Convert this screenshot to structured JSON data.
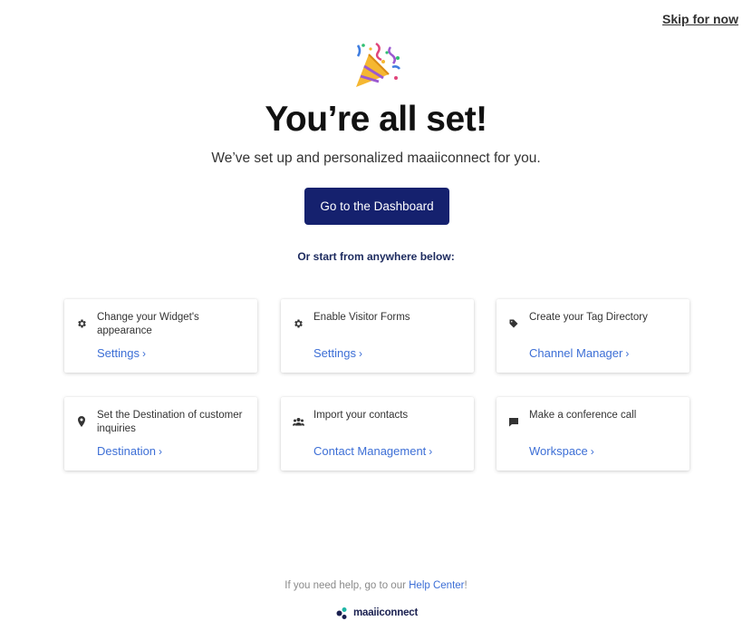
{
  "header": {
    "skip_label": "Skip for now"
  },
  "hero": {
    "icon": "party-popper-icon",
    "title": "You’re all set!",
    "subtitle": "We’ve set up and personalized maaiiconnect for you."
  },
  "primary_button": {
    "label": "Go to the Dashboard"
  },
  "or_start_label": "Or start from anywhere below:",
  "cards": [
    {
      "title": "Change your Widget's appearance",
      "link": "Settings",
      "icon": "gear-icon"
    },
    {
      "title": "Enable Visitor Forms",
      "link": "Settings",
      "icon": "gear-icon"
    },
    {
      "title": "Create your Tag Directory",
      "link": "Channel Manager",
      "icon": "tag-icon"
    },
    {
      "title": "Set the Destination of customer inquiries",
      "link": "Destination",
      "icon": "location-pin-icon"
    },
    {
      "title": "Import your contacts",
      "link": "Contact Management",
      "icon": "people-icon"
    },
    {
      "title": "Make a conference call",
      "link": "Workspace",
      "icon": "chat-bubble-icon"
    }
  ],
  "chevron": "›",
  "footer": {
    "help_prefix": "If you need help, go to our ",
    "help_link": "Help Center",
    "help_suffix": "!",
    "brand": "maaiiconnect"
  },
  "colors": {
    "primary": "#15216e",
    "link": "#3d6fd6",
    "brand_teal": "#1fb6a6"
  }
}
